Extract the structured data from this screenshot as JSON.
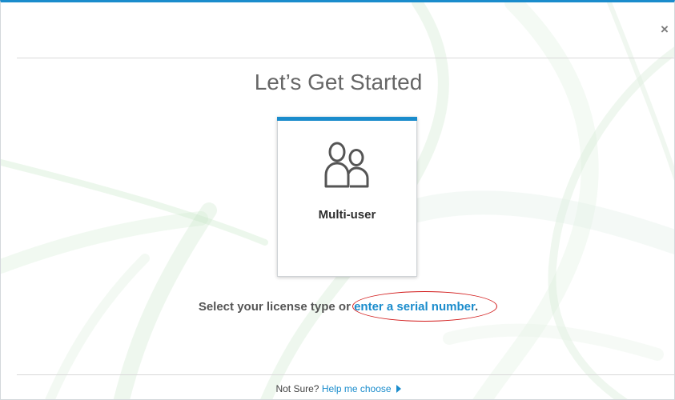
{
  "window": {
    "close_glyph": "×"
  },
  "header": {
    "title": "Let’s Get Started"
  },
  "cards": [
    {
      "label": "Multi-user",
      "icon": "multi-user-icon"
    }
  ],
  "instruction": {
    "prefix": "Select your license type or ",
    "link_text": "enter a serial number",
    "suffix": "."
  },
  "footer": {
    "prefix": "Not Sure? ",
    "link_text": "Help me choose",
    "icon": "play-icon"
  },
  "colors": {
    "accent": "#1a8ccc",
    "annotation": "#d21a1a"
  }
}
